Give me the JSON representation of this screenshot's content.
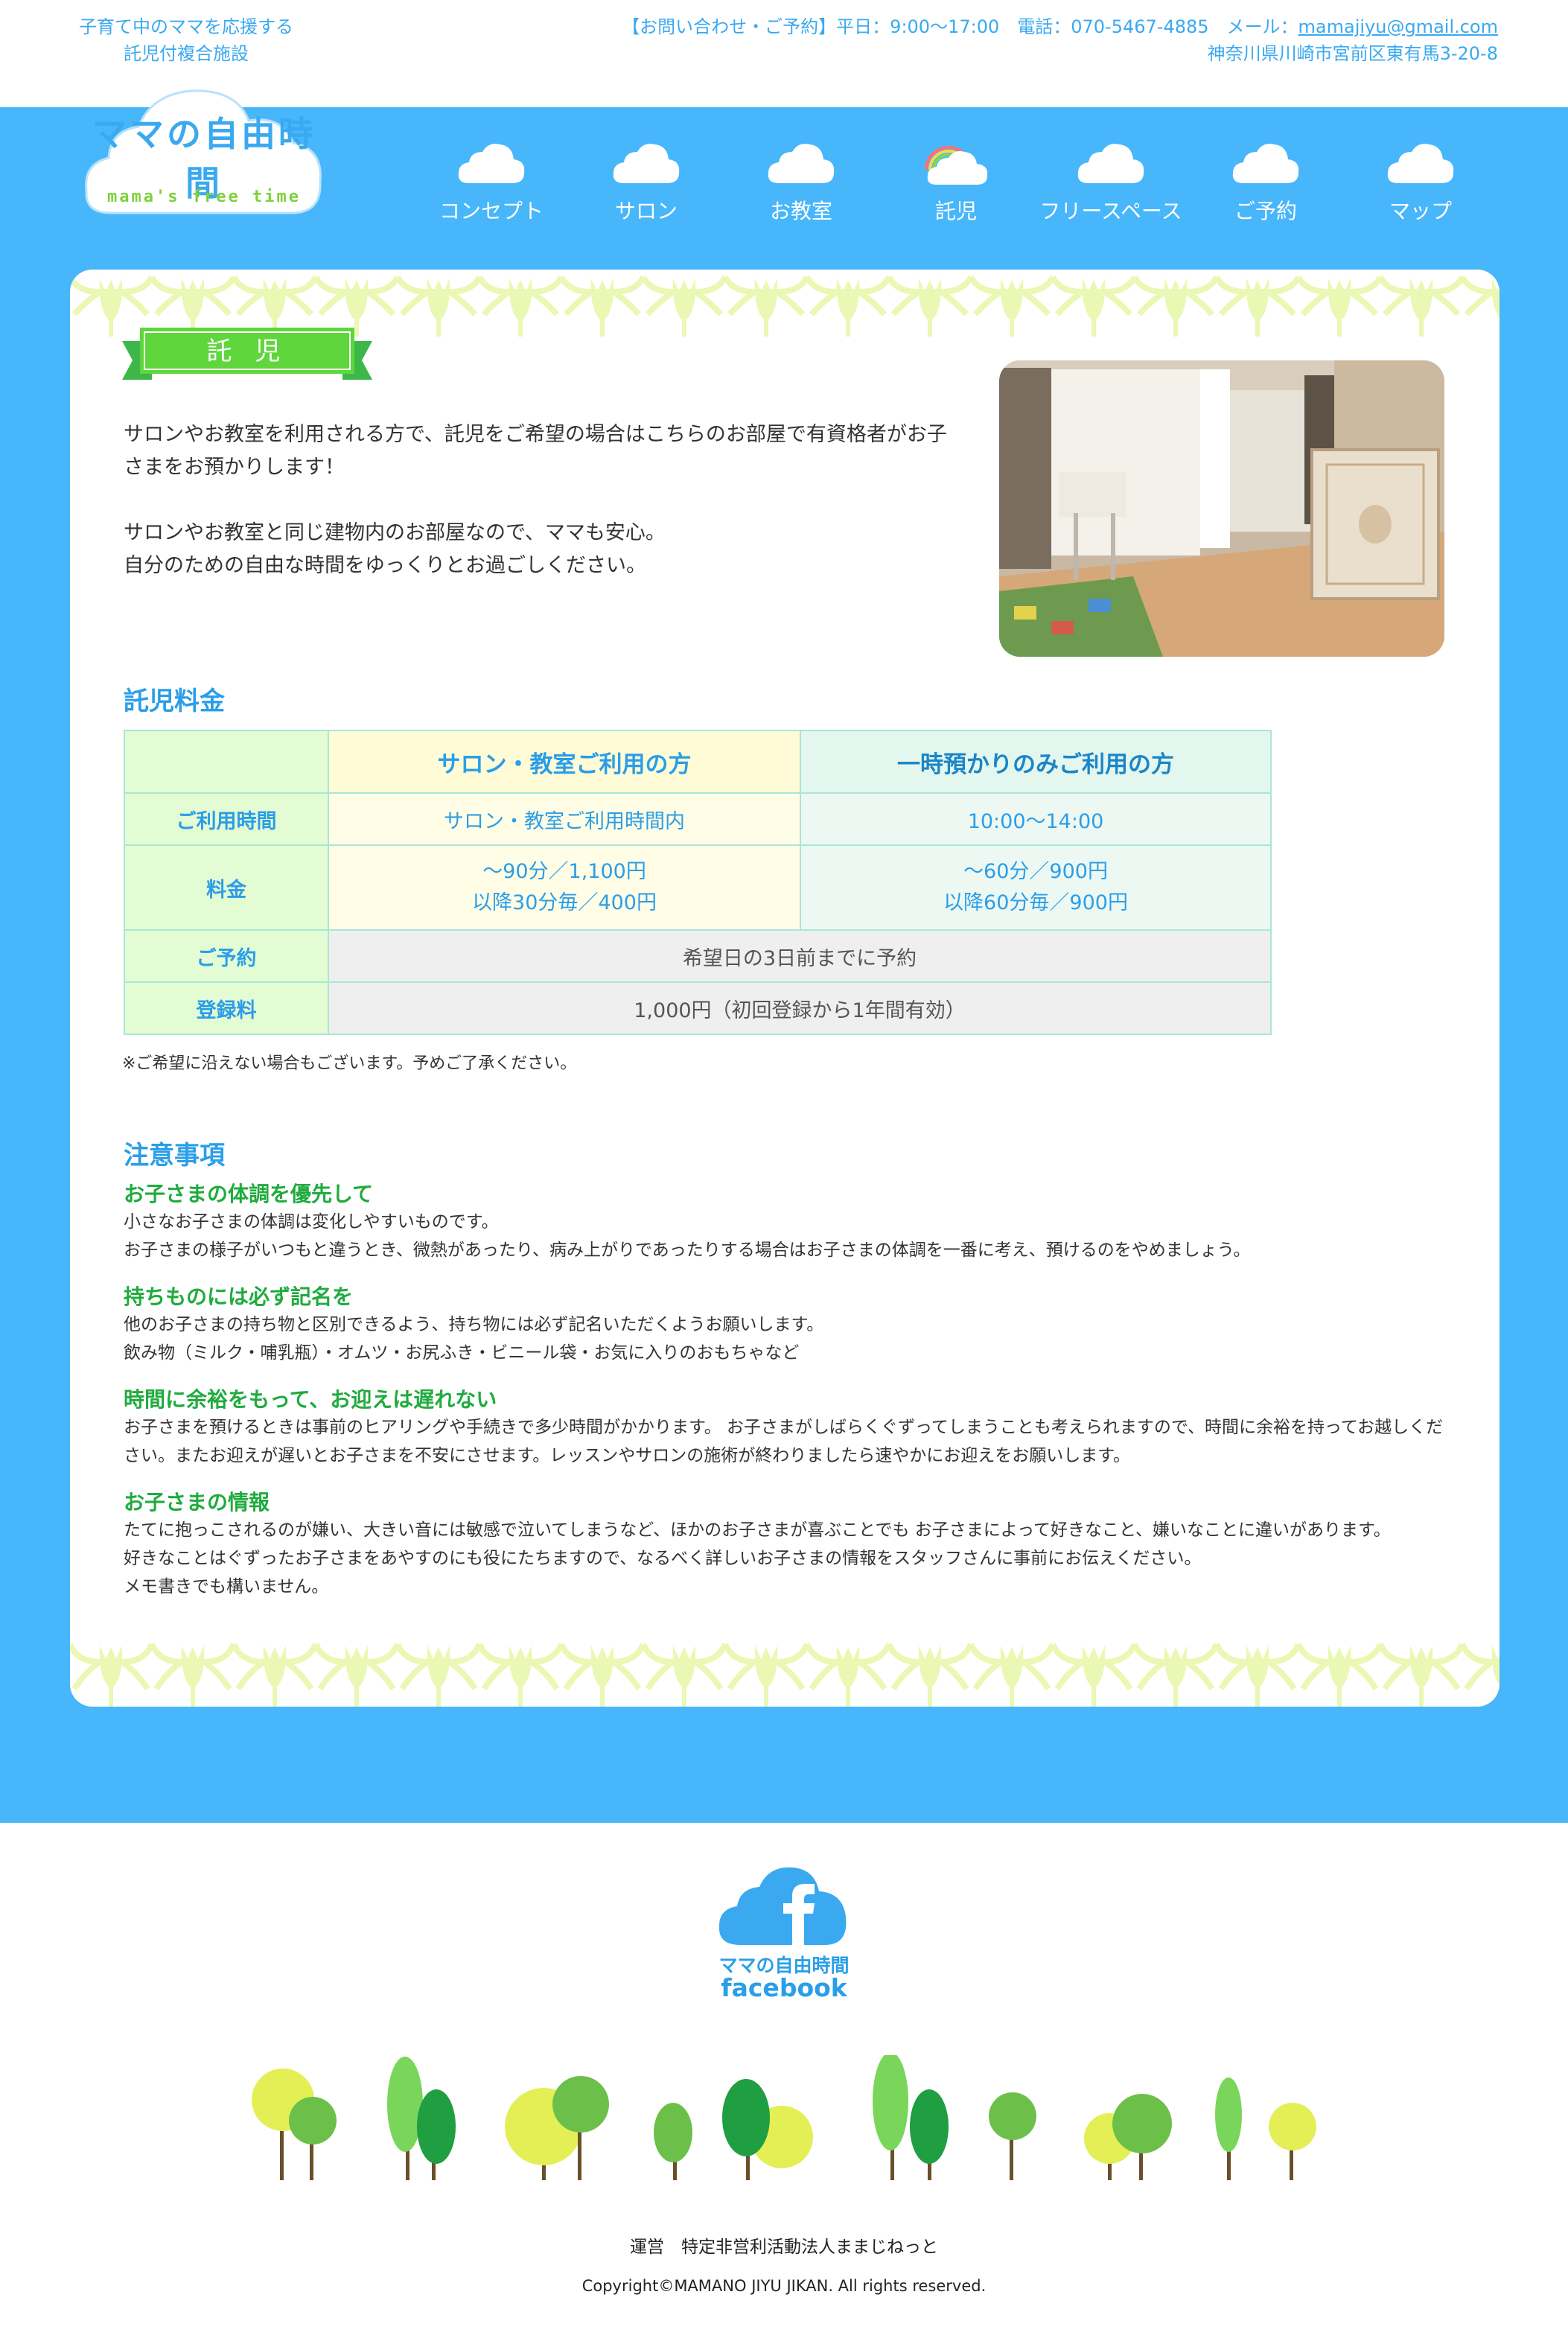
{
  "header": {
    "tagline": [
      "子育て中のママを応援する",
      "託児付複合施設"
    ],
    "contact_line": "【お問い合わせ・ご予約】平日：9:00〜17:00　電話：070-5467-4885　メール：",
    "email": "mamajiyu@gmail.com",
    "address": "神奈川県川崎市宮前区東有馬3-20-8"
  },
  "logo": {
    "title": "ママの自由時間",
    "subtitle": "mama's free time"
  },
  "nav": [
    {
      "label": "コンセプト",
      "icon": "cloud-icon"
    },
    {
      "label": "サロン",
      "icon": "cloud-icon"
    },
    {
      "label": "お教室",
      "icon": "cloud-icon"
    },
    {
      "label": "託児",
      "icon": "rainbow-cloud-icon",
      "active": true
    },
    {
      "label": "フリースペース",
      "icon": "cloud-icon"
    },
    {
      "label": "ご予約",
      "icon": "cloud-icon"
    },
    {
      "label": "マップ",
      "icon": "cloud-icon"
    }
  ],
  "page": {
    "heading": "託 児",
    "intro": [
      "サロンやお教室を利用される方で、託児をご希望の場合はこちらのお部屋で有資格者がお子さまをお預かりします！",
      "サロンやお教室と同じ建物内のお部屋なので、ママも安心。\n自分のための自由な時間をゆっくりとお過ごしください。"
    ],
    "photo_alt": "nursery-room-photo"
  },
  "fees": {
    "title": "託児料金",
    "col_a": "サロン・教室ご利用の方",
    "col_b": "一時預かりのみご利用の方",
    "rows": [
      {
        "label": "ご利用時間",
        "a": "サロン・教室ご利用時間内",
        "b": "10:00〜14:00"
      },
      {
        "label": "料金",
        "a": "〜90分／1,100円\n以降30分毎／400円",
        "b": "〜60分／900円\n以降60分毎／900円"
      },
      {
        "label": "ご予約",
        "merged": "希望日の3日前までに予約"
      },
      {
        "label": "登録料",
        "merged": "1,000円（初回登録から1年間有効）"
      }
    ],
    "note": "※ご希望に沿えない場合もございます。予めご了承ください。"
  },
  "cautions": {
    "title": "注意事項",
    "items": [
      {
        "heading": "お子さまの体調を優先して",
        "lines": [
          "小さなお子さまの体調は変化しやすいものです。",
          "お子さまの様子がいつもと違うとき、微熱があったり、病み上がりであったりする場合はお子さまの体調を一番に考え、預けるのをやめましょう。"
        ]
      },
      {
        "heading": "持ちものには必ず記名を",
        "lines": [
          "他のお子さまの持ち物と区別できるよう、持ち物には必ず記名いただくようお願いします。",
          "飲み物（ミルク・哺乳瓶）・オムツ・お尻ふき・ビニール袋・お気に入りのおもちゃなど"
        ]
      },
      {
        "heading": "時間に余裕をもって、お迎えは遅れない",
        "lines": [
          "お子さまを預けるときは事前のヒアリングや手続きで多少時間がかかります。 お子さまがしばらくぐずってしまうことも考えられますので、時間に余裕を持ってお越しください。またお迎えが遅いとお子さまを不安にさせます。レッスンやサロンの施術が終わりましたら速やかにお迎えをお願いします。"
        ]
      },
      {
        "heading": "お子さまの情報",
        "lines": [
          "たてに抱っこされるのが嫌い、大きい音には敏感で泣いてしまうなど、ほかのお子さまが喜ぶことでも お子さまによって好きなこと、嫌いなことに違いがあります。",
          "好きなことはぐずったお子さまをあやすのにも役にたちますので、なるべく詳しいお子さまの情報をスタッフさんに事前にお伝えください。",
          "メモ書きでも構いません。"
        ]
      }
    ]
  },
  "footer": {
    "fb_line1": "ママの自由時間",
    "fb_line2": "facebook",
    "operator": "運営　特定非営利活動法人ままじねっと",
    "copyright": "Copyright©MAMANO JIYU JIKAN. All rights reserved."
  },
  "colors": {
    "brand_blue": "#47b6fb",
    "text_blue": "#2a9ee8",
    "green": "#20ab3e",
    "ribbon_green": "#5ed63c"
  }
}
